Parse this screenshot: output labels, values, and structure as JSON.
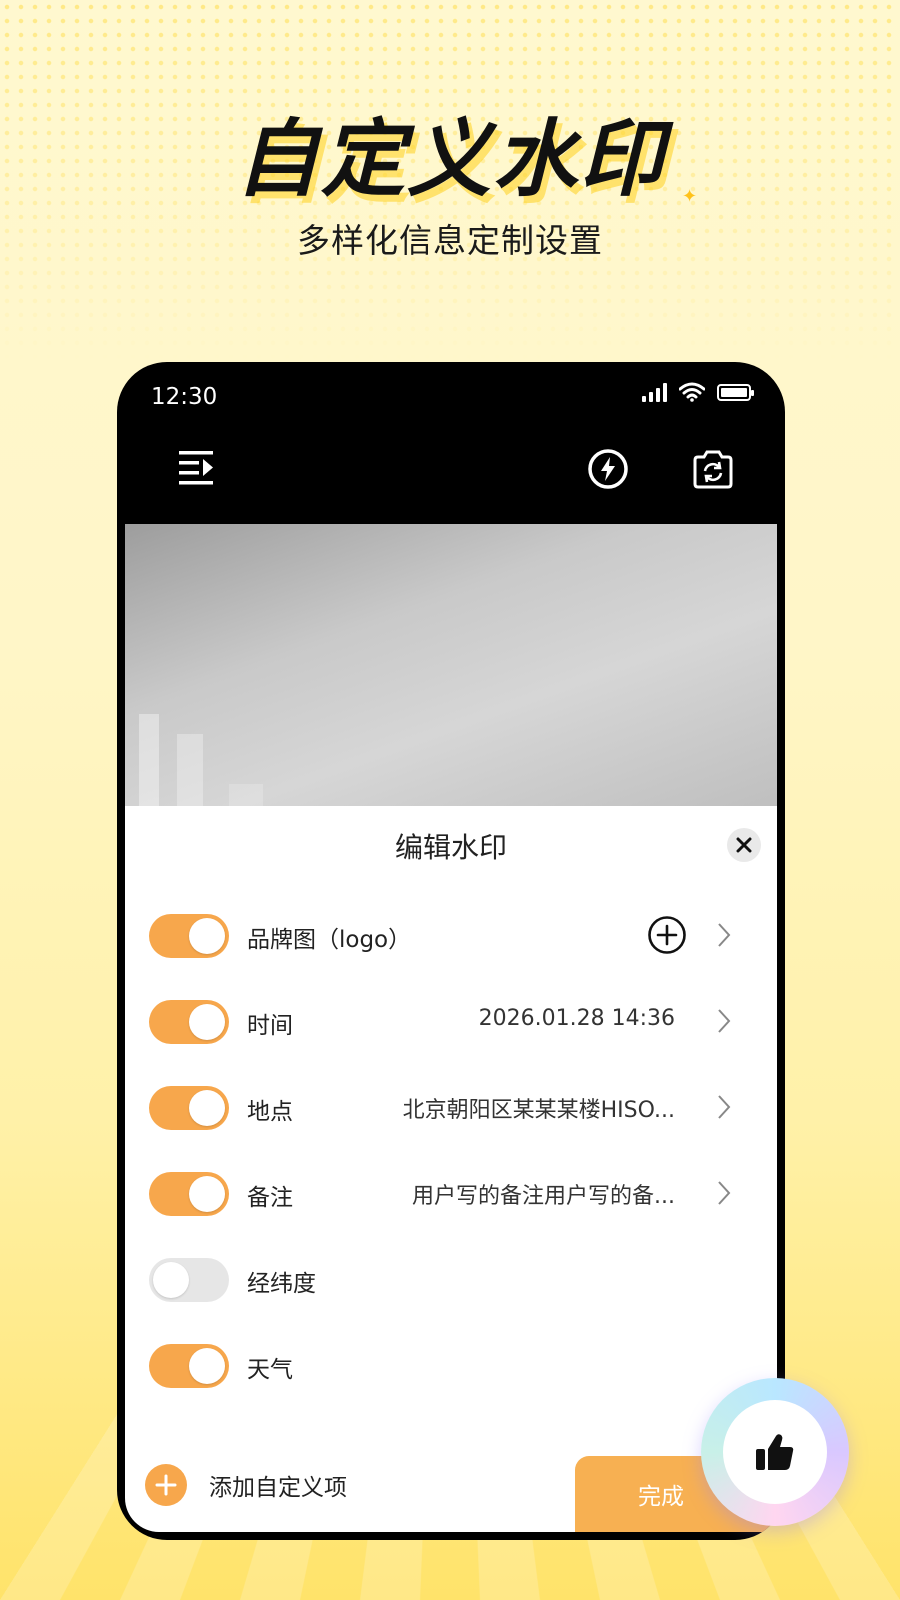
{
  "promo": {
    "title": "自定义水印",
    "subtitle": "多样化信息定制设置"
  },
  "status_bar": {
    "time": "12:30"
  },
  "toolbar": {
    "icons": [
      "menu-icon",
      "flash-icon",
      "camera-switch-icon"
    ]
  },
  "sheet": {
    "title": "编辑水印",
    "rows": [
      {
        "label": "品牌图（logo）",
        "value": "",
        "enabled": true,
        "has_add": true,
        "has_chevron": true
      },
      {
        "label": "时间",
        "value": "2026.01.28 14:36",
        "enabled": true,
        "has_add": false,
        "has_chevron": true
      },
      {
        "label": "地点",
        "value": "北京朝阳区某某某楼HISO...",
        "enabled": true,
        "has_add": false,
        "has_chevron": true
      },
      {
        "label": "备注",
        "value": "用户写的备注用户写的备...",
        "enabled": true,
        "has_add": false,
        "has_chevron": true
      },
      {
        "label": "经纬度",
        "value": "",
        "enabled": false,
        "has_add": false,
        "has_chevron": false
      },
      {
        "label": "天气",
        "value": "",
        "enabled": true,
        "has_add": false,
        "has_chevron": false
      }
    ],
    "add_custom_label": "添加自定义项",
    "done_label": "完成"
  },
  "colors": {
    "accent": "#f7a74c",
    "toggle_off": "#e6e6e6",
    "background": "#fff6c8"
  }
}
